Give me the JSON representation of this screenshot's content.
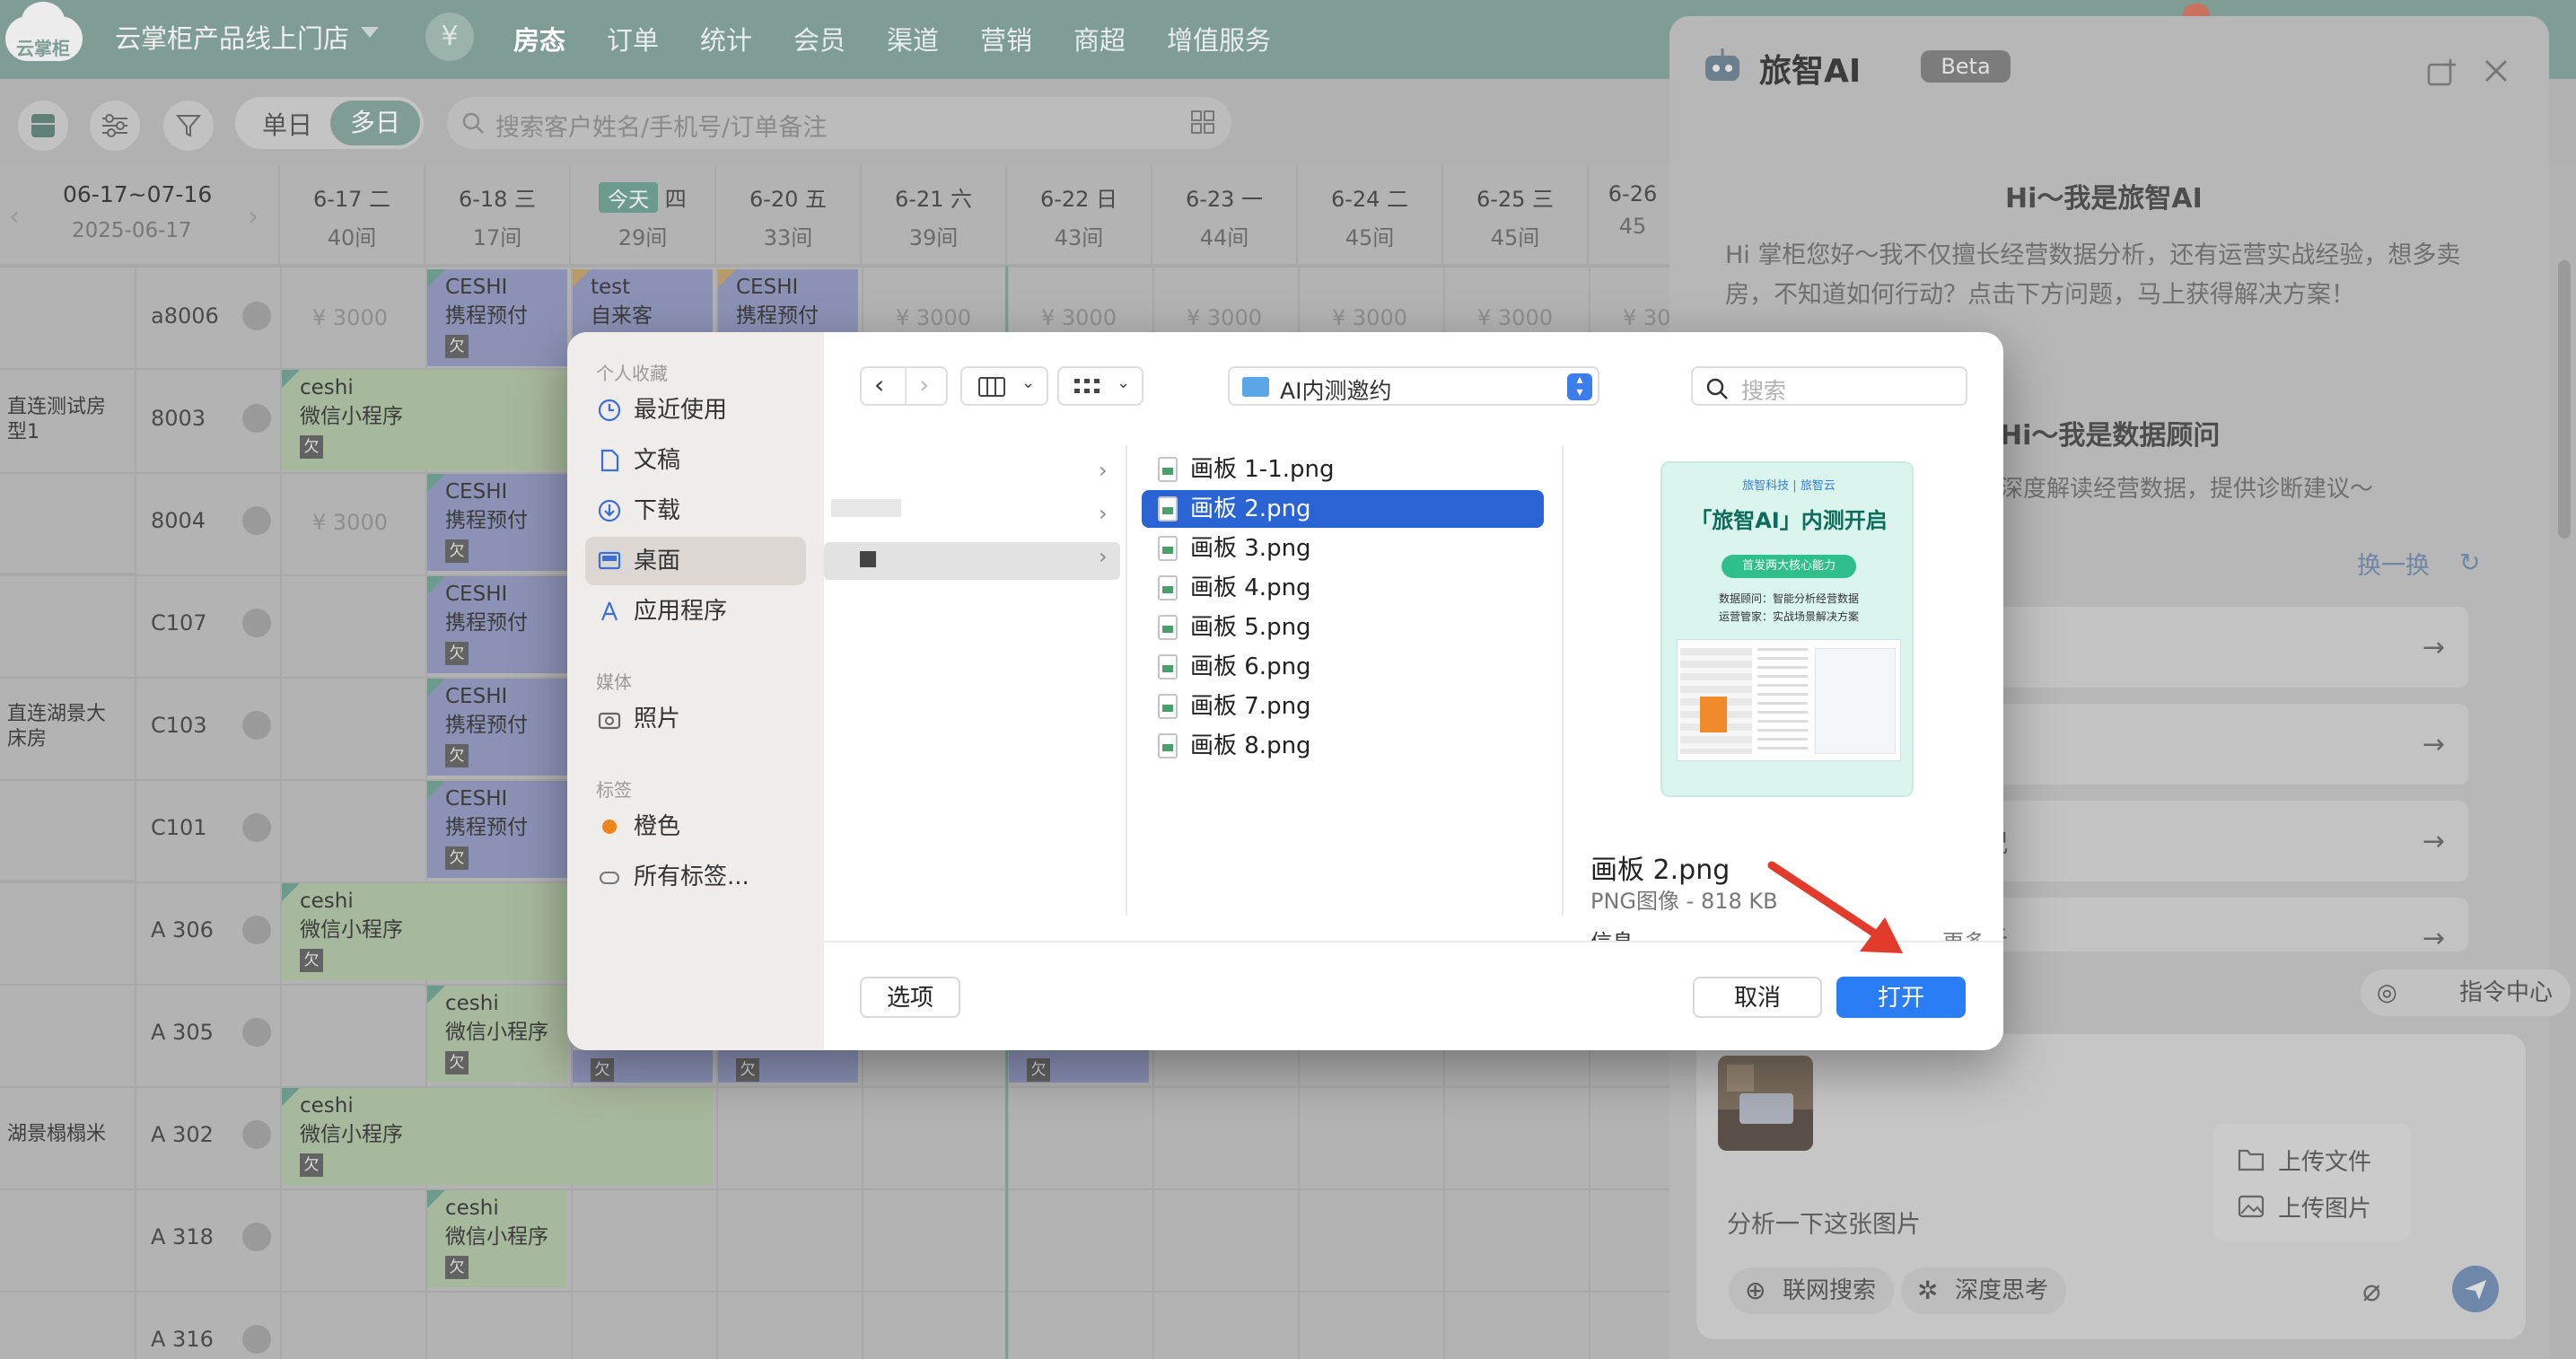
{
  "app": {
    "logo_text": "云掌柜",
    "store_name": "云掌柜产品线上门店",
    "yen_symbol": "¥",
    "nav": [
      "房态",
      "订单",
      "统计",
      "会员",
      "渠道",
      "营销",
      "商超",
      "增值服务"
    ]
  },
  "toolbar": {
    "seg_single": "单日",
    "seg_multi": "多日",
    "search_placeholder": "搜索客户姓名/手机号/订单备注"
  },
  "calendar": {
    "range": "06-17~07-16",
    "date": "2025-06-17",
    "days": [
      {
        "d": "6-17",
        "w": "二",
        "r": "40间"
      },
      {
        "d": "6-18",
        "w": "三",
        "r": "17间"
      },
      {
        "d": "今天",
        "w": "四",
        "r": "29间",
        "today": true
      },
      {
        "d": "6-20",
        "w": "五",
        "r": "33间"
      },
      {
        "d": "6-21",
        "w": "六",
        "r": "39间"
      },
      {
        "d": "6-22",
        "w": "日",
        "r": "43间"
      },
      {
        "d": "6-23",
        "w": "一",
        "r": "44间"
      },
      {
        "d": "6-24",
        "w": "二",
        "r": "45间"
      },
      {
        "d": "6-25",
        "w": "三",
        "r": "45间"
      },
      {
        "d": "6-26",
        "w": "",
        "r": "45"
      }
    ],
    "room_types": [
      "直连测试房型1",
      "直连湖景大床房",
      "湖景榻榻米"
    ],
    "rooms": [
      "a8006",
      "8003",
      "8004",
      "C107",
      "C103",
      "C101",
      "A 306",
      "A 305",
      "A 302",
      "A 318",
      "A 316"
    ],
    "price": "¥ 3000",
    "owed": "欠",
    "bookings": {
      "b1": [
        "CESHI",
        "携程预付"
      ],
      "b2": [
        "test",
        "自来客"
      ],
      "b3": [
        "CESHI",
        "携程预付"
      ],
      "b4": [
        "ceshi",
        "微信小程序"
      ],
      "b5": [
        "CESHI",
        "携程预付"
      ],
      "b6": [
        "CESHI",
        "携程预付"
      ],
      "b7": [
        "CESHI",
        "携程预付"
      ],
      "b8": [
        "CESHI",
        "携程预付"
      ],
      "b9": [
        "ceshi",
        "微信小程序"
      ],
      "b10": [
        "ceshi",
        "微信小程序"
      ],
      "b11": [
        "ceshi",
        "微信小程序"
      ],
      "b12": [
        "ceshi",
        "微信小程序"
      ]
    }
  },
  "ai_panel": {
    "title": "旅智AI",
    "beta": "Beta",
    "greeting": "Hi～我是旅智AI",
    "intro_1": "Hi 掌柜您好～我不仅擅长经营数据分析，还有运营实战经验，想多卖",
    "intro_2": "房，不知道如何行动？点击下方问题，马上获得解决方案！",
    "advisor_title": "Hi～我是数据顾问",
    "advisor_desc": "深度解读经营数据，提供诊断建议～",
    "refresh": "换一换",
    "q3_tail": "况",
    "q4_tail": "析",
    "command_center": "指令中心",
    "upload_file": "上传文件",
    "upload_image": "上传图片",
    "input_text": "分析一下这张图片",
    "web_search": "联网搜索",
    "deep_think": "深度思考"
  },
  "dialog": {
    "sb_favorites": "个人收藏",
    "sb_items": [
      "最近使用",
      "文稿",
      "下载",
      "桌面",
      "应用程序"
    ],
    "sb_media": "媒体",
    "sb_photos": "照片",
    "sb_tags": "标签",
    "sb_tag_orange": "橙色",
    "sb_all_tags": "所有标签...",
    "path": "AI内测邀约",
    "search_placeholder": "搜索",
    "files": [
      "画板 1-1.png",
      "画板 2.png",
      "画板 3.png",
      "画板 4.png",
      "画板 5.png",
      "画板 6.png",
      "画板 7.png",
      "画板 8.png"
    ],
    "selected_index": 1,
    "preview_name": "画板 2.png",
    "preview_meta": "PNG图像 - 818 KB",
    "preview_info_clip": "信息",
    "preview_more_clip": "更多",
    "poster": {
      "brand": "旅智科技 | 旅智云",
      "headline": "「旅智AI」内测开启",
      "pill": "首发两大核心能力",
      "line1": "数据顾问：智能分析经营数据",
      "line2": "运营管家：实战场景解决方案"
    },
    "options_btn": "选项",
    "cancel_btn": "取消",
    "open_btn": "打开"
  },
  "colors": {
    "accent_green": "#7f9d95",
    "primary_blue": "#2a7df5",
    "selection_blue": "#2a63d4",
    "arrow_red": "#e23b2b"
  }
}
